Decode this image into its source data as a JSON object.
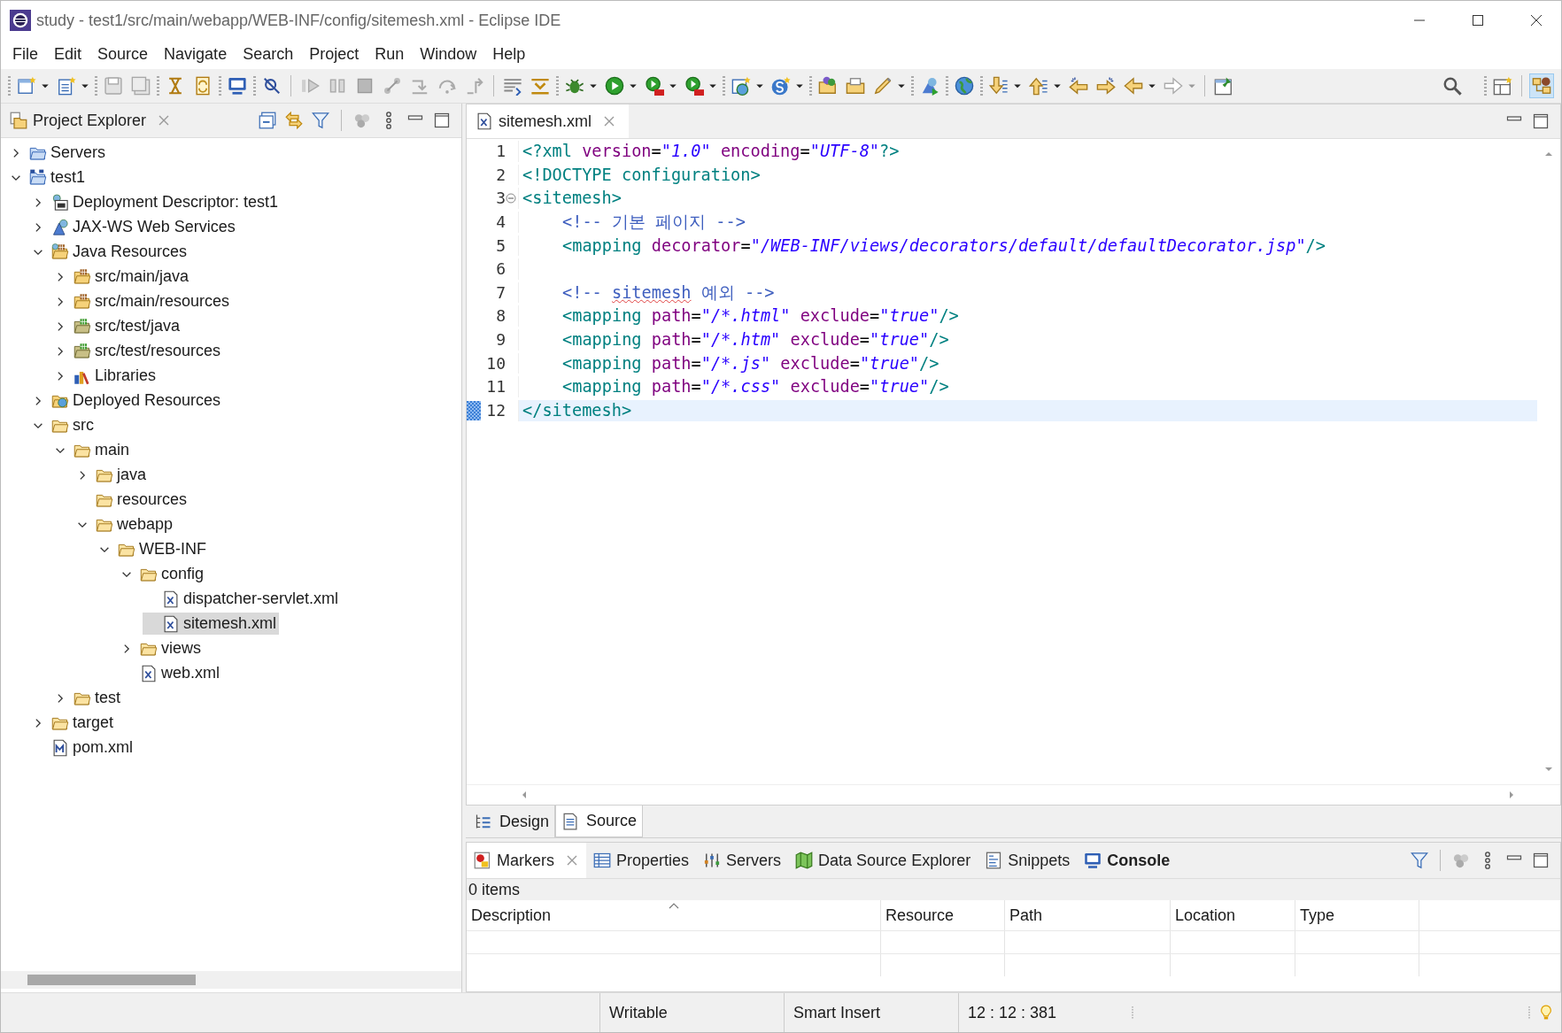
{
  "window": {
    "title": "study - test1/src/main/webapp/WEB-INF/config/sitemesh.xml - Eclipse IDE"
  },
  "menu": [
    "File",
    "Edit",
    "Source",
    "Navigate",
    "Search",
    "Project",
    "Run",
    "Window",
    "Help"
  ],
  "explorer": {
    "title": "Project Explorer",
    "tree": [
      {
        "label": "Servers",
        "kind": "servers",
        "expanded": false,
        "selected": false
      },
      {
        "label": "test1",
        "kind": "project",
        "expanded": true,
        "selected": false,
        "children": [
          {
            "label": "Deployment Descriptor: test1",
            "kind": "descriptor",
            "expanded": false,
            "selected": false
          },
          {
            "label": "JAX-WS Web Services",
            "kind": "webservices",
            "expanded": false,
            "selected": false
          },
          {
            "label": "Java Resources",
            "kind": "java-resources",
            "expanded": true,
            "selected": false,
            "children": [
              {
                "label": "src/main/java",
                "kind": "package-root",
                "expanded": false,
                "selected": false
              },
              {
                "label": "src/main/resources",
                "kind": "package-root",
                "expanded": false,
                "selected": false
              },
              {
                "label": "src/test/java",
                "kind": "test-package-root",
                "expanded": false,
                "selected": false
              },
              {
                "label": "src/test/resources",
                "kind": "test-package-root",
                "expanded": false,
                "selected": false
              },
              {
                "label": "Libraries",
                "kind": "libraries",
                "expanded": false,
                "selected": false
              }
            ]
          },
          {
            "label": "Deployed Resources",
            "kind": "deployed",
            "expanded": false,
            "selected": false
          },
          {
            "label": "src",
            "kind": "folder",
            "expanded": true,
            "selected": false,
            "children": [
              {
                "label": "main",
                "kind": "folder",
                "expanded": true,
                "selected": false,
                "children": [
                  {
                    "label": "java",
                    "kind": "folder",
                    "expanded": false,
                    "selected": false
                  },
                  {
                    "label": "resources",
                    "kind": "folder",
                    "selected": false
                  },
                  {
                    "label": "webapp",
                    "kind": "folder",
                    "expanded": true,
                    "selected": false,
                    "children": [
                      {
                        "label": "WEB-INF",
                        "kind": "folder",
                        "expanded": true,
                        "selected": false,
                        "children": [
                          {
                            "label": "config",
                            "kind": "folder",
                            "expanded": true,
                            "selected": false,
                            "children": [
                              {
                                "label": "dispatcher-servlet.xml",
                                "kind": "xml",
                                "selected": false
                              },
                              {
                                "label": "sitemesh.xml",
                                "kind": "xml",
                                "selected": true
                              }
                            ]
                          },
                          {
                            "label": "views",
                            "kind": "folder",
                            "expanded": false,
                            "selected": false
                          },
                          {
                            "label": "web.xml",
                            "kind": "xml",
                            "selected": false
                          }
                        ]
                      }
                    ]
                  }
                ]
              },
              {
                "label": "test",
                "kind": "folder",
                "expanded": false,
                "selected": false
              }
            ]
          },
          {
            "label": "target",
            "kind": "folder",
            "expanded": false,
            "selected": false
          },
          {
            "label": "pom.xml",
            "kind": "maven",
            "selected": false
          }
        ]
      }
    ]
  },
  "editor": {
    "tabs": [
      {
        "label": "sitemesh.xml",
        "selected": true
      }
    ],
    "lines": [
      {
        "number": "1",
        "current": false,
        "tokens": [
          {
            "kind": "tag",
            "text": "<?xml "
          },
          {
            "kind": "attr",
            "text": "version"
          },
          {
            "kind": "plain",
            "text": "="
          },
          {
            "kind": "value",
            "text": "\"1.0\""
          },
          {
            "kind": "attr",
            "text": " encoding"
          },
          {
            "kind": "plain",
            "text": "="
          },
          {
            "kind": "value",
            "text": "\"UTF-8\""
          },
          {
            "kind": "tag",
            "text": "?>"
          }
        ]
      },
      {
        "number": "2",
        "current": false,
        "tokens": [
          {
            "kind": "tag",
            "text": "<!DOCTYPE configuration>"
          }
        ]
      },
      {
        "number": "3",
        "current": false,
        "foldable": true,
        "tokens": [
          {
            "kind": "tag",
            "text": "<sitemesh>"
          }
        ]
      },
      {
        "number": "4",
        "current": false,
        "indented": true,
        "tokens": [
          {
            "kind": "comment",
            "text": "<!-- 기본 페이지 -->"
          }
        ]
      },
      {
        "number": "5",
        "current": false,
        "indented": true,
        "tokens": [
          {
            "kind": "tag",
            "text": "<mapping "
          },
          {
            "kind": "attr",
            "text": "decorator"
          },
          {
            "kind": "plain",
            "text": "="
          },
          {
            "kind": "value",
            "text": "\"/WEB-INF/views/decorators/default/defaultDecorator.jsp\""
          },
          {
            "kind": "tag",
            "text": "/>"
          }
        ]
      },
      {
        "number": "6",
        "current": false
      },
      {
        "number": "7",
        "current": false,
        "indented": true,
        "tokens": [
          {
            "kind": "comment",
            "text": "<!-- "
          },
          {
            "kind": "misspelled",
            "text": "sitemesh"
          },
          {
            "kind": "comment",
            "text": " 예외 -->"
          }
        ]
      },
      {
        "number": "8",
        "current": false,
        "indented": true,
        "tokens": [
          {
            "kind": "tag",
            "text": "<mapping "
          },
          {
            "kind": "attr",
            "text": "path"
          },
          {
            "kind": "plain",
            "text": "="
          },
          {
            "kind": "value",
            "text": "\"/*.html\""
          },
          {
            "kind": "attr",
            "text": " exclude"
          },
          {
            "kind": "plain",
            "text": "="
          },
          {
            "kind": "value",
            "text": "\"true\""
          },
          {
            "kind": "tag",
            "text": "/>"
          }
        ]
      },
      {
        "number": "9",
        "current": false,
        "indented": true,
        "tokens": [
          {
            "kind": "tag",
            "text": "<mapping "
          },
          {
            "kind": "attr",
            "text": "path"
          },
          {
            "kind": "plain",
            "text": "="
          },
          {
            "kind": "value",
            "text": "\"/*.htm\""
          },
          {
            "kind": "attr",
            "text": " exclude"
          },
          {
            "kind": "plain",
            "text": "="
          },
          {
            "kind": "value",
            "text": "\"true\""
          },
          {
            "kind": "tag",
            "text": "/>"
          }
        ]
      },
      {
        "number": "10",
        "current": false,
        "indented": true,
        "tokens": [
          {
            "kind": "tag",
            "text": "<mapping "
          },
          {
            "kind": "attr",
            "text": "path"
          },
          {
            "kind": "plain",
            "text": "="
          },
          {
            "kind": "value",
            "text": "\"/*.js\""
          },
          {
            "kind": "attr",
            "text": " exclude"
          },
          {
            "kind": "plain",
            "text": "="
          },
          {
            "kind": "value",
            "text": "\"true\""
          },
          {
            "kind": "tag",
            "text": "/>"
          }
        ]
      },
      {
        "number": "11",
        "current": false,
        "indented": true,
        "tokens": [
          {
            "kind": "tag",
            "text": "<mapping "
          },
          {
            "kind": "attr",
            "text": "path"
          },
          {
            "kind": "plain",
            "text": "="
          },
          {
            "kind": "value",
            "text": "\"/*.css\""
          },
          {
            "kind": "attr",
            "text": " exclude"
          },
          {
            "kind": "plain",
            "text": "="
          },
          {
            "kind": "value",
            "text": "\"true\""
          },
          {
            "kind": "tag",
            "text": "/>"
          }
        ]
      },
      {
        "number": "12",
        "current": true,
        "tokens": [
          {
            "kind": "tag",
            "text": "</sitemesh>"
          }
        ]
      }
    ],
    "page_tabs": [
      {
        "label": "Design",
        "kind": "design",
        "selected": false
      },
      {
        "label": "Source",
        "kind": "source",
        "selected": true
      }
    ]
  },
  "bottom_panel": {
    "tabs": [
      {
        "label": "Markers",
        "kind": "markers",
        "selected": true,
        "emphasized": false
      },
      {
        "label": "Properties",
        "kind": "properties",
        "selected": false,
        "emphasized": false
      },
      {
        "label": "Servers",
        "kind": "servers",
        "selected": false,
        "emphasized": false
      },
      {
        "label": "Data Source Explorer",
        "kind": "datasource",
        "selected": false,
        "emphasized": false
      },
      {
        "label": "Snippets",
        "kind": "snippets",
        "selected": false,
        "emphasized": false
      },
      {
        "label": "Console",
        "kind": "console",
        "selected": false,
        "emphasized": true
      }
    ],
    "summary": "0 items",
    "columns": [
      {
        "label": "Description",
        "sorted": true
      },
      {
        "label": "Resource",
        "sorted": false
      },
      {
        "label": "Path",
        "sorted": false
      },
      {
        "label": "Location",
        "sorted": false
      },
      {
        "label": "Type",
        "sorted": false
      }
    ]
  },
  "status_bar": [
    "Writable",
    "Smart Insert",
    "12 : 12 : 381"
  ]
}
